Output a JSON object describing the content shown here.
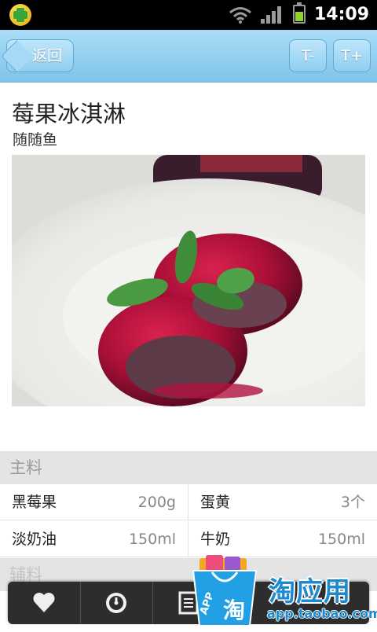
{
  "status_bar": {
    "time": "14:09"
  },
  "toolbar": {
    "back_label": "返回",
    "font_smaller_label": "T-",
    "font_larger_label": "T+"
  },
  "recipe": {
    "title": "莓果冰淇淋",
    "author": "随随鱼"
  },
  "ingredients": {
    "main_header": "主料",
    "main_rows": [
      [
        {
          "name": "黑莓果",
          "qty": "200g"
        },
        {
          "name": "蛋黄",
          "qty": "3个"
        }
      ],
      [
        {
          "name": "淡奶油",
          "qty": "150ml"
        },
        {
          "name": "牛奶",
          "qty": "150ml"
        }
      ]
    ],
    "aux_header": "辅料"
  },
  "bottom_bar": {
    "icons": [
      "heart-icon",
      "gauge-icon",
      "list-icon"
    ]
  },
  "ad": {
    "bag_text": "APP",
    "bag_char": "淘",
    "brand": "淘应用",
    "url": "app.taobao.com"
  },
  "colors": {
    "toolbar": "#8ecdf0",
    "section_bg": "#e4e4e4",
    "brand_blue": "#1b8ad0"
  }
}
